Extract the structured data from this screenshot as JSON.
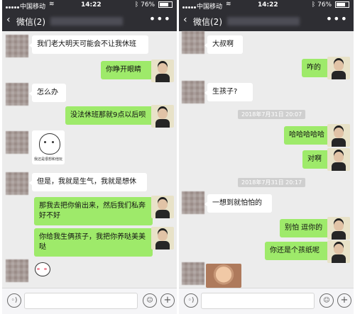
{
  "status_bar": {
    "carrier": "中国移动",
    "wifi_icon": "wifi-icon",
    "time": "14:22",
    "battery_pct": 76,
    "battery_label": "76%"
  },
  "nav": {
    "back_icon": "chevron-left-icon",
    "title": "微信(2)",
    "more_label": "•••"
  },
  "left_messages": [
    {
      "side": "in",
      "text": "我们老大明天可能会不让我休班"
    },
    {
      "side": "out",
      "text": "你睁开眼睛"
    },
    {
      "side": "in",
      "text": "怎么办"
    },
    {
      "side": "out",
      "text": "没法休班那就9点以后呗"
    },
    {
      "side": "in",
      "type": "sticker",
      "caption": "我还是很想和他玩"
    },
    {
      "side": "in",
      "text": "但是，我就是生气，我就是想休"
    },
    {
      "side": "out",
      "text": "那我去把你偷出来，然后我们私奔好不好"
    },
    {
      "side": "out",
      "text": "你给我生俩孩子，我把你养哒美美哒"
    },
    {
      "side": "in",
      "type": "sticker"
    }
  ],
  "right_messages": [
    {
      "side": "in",
      "text": "大叔啊"
    },
    {
      "side": "out",
      "text": "咋的"
    },
    {
      "side": "in",
      "text": "生孩子?"
    },
    {
      "type": "timestamp",
      "text": "2018年7月31日 20:07"
    },
    {
      "side": "out",
      "text": "哈哈哈哈哈"
    },
    {
      "side": "out",
      "text": "对啊"
    },
    {
      "type": "timestamp",
      "text": "2018年7月31日 20:17"
    },
    {
      "side": "in",
      "text": "一想到就怕怕的"
    },
    {
      "side": "out",
      "text": "别怕 逗你的"
    },
    {
      "side": "out",
      "text": "你还是个孩纸呢"
    },
    {
      "side": "in",
      "type": "photo"
    }
  ],
  "input_bar": {
    "voice_icon": "voice-icon",
    "emoji_icon": "emoji-icon",
    "plus_icon": "plus-icon",
    "voice_glyph": "◦)",
    "emoji_glyph": "☺",
    "plus_glyph": "+"
  },
  "colors": {
    "top_bar": "#2e2e33",
    "chat_bg": "#ececec",
    "outgoing_bubble": "#9eea6a",
    "incoming_bubble": "#ffffff"
  }
}
